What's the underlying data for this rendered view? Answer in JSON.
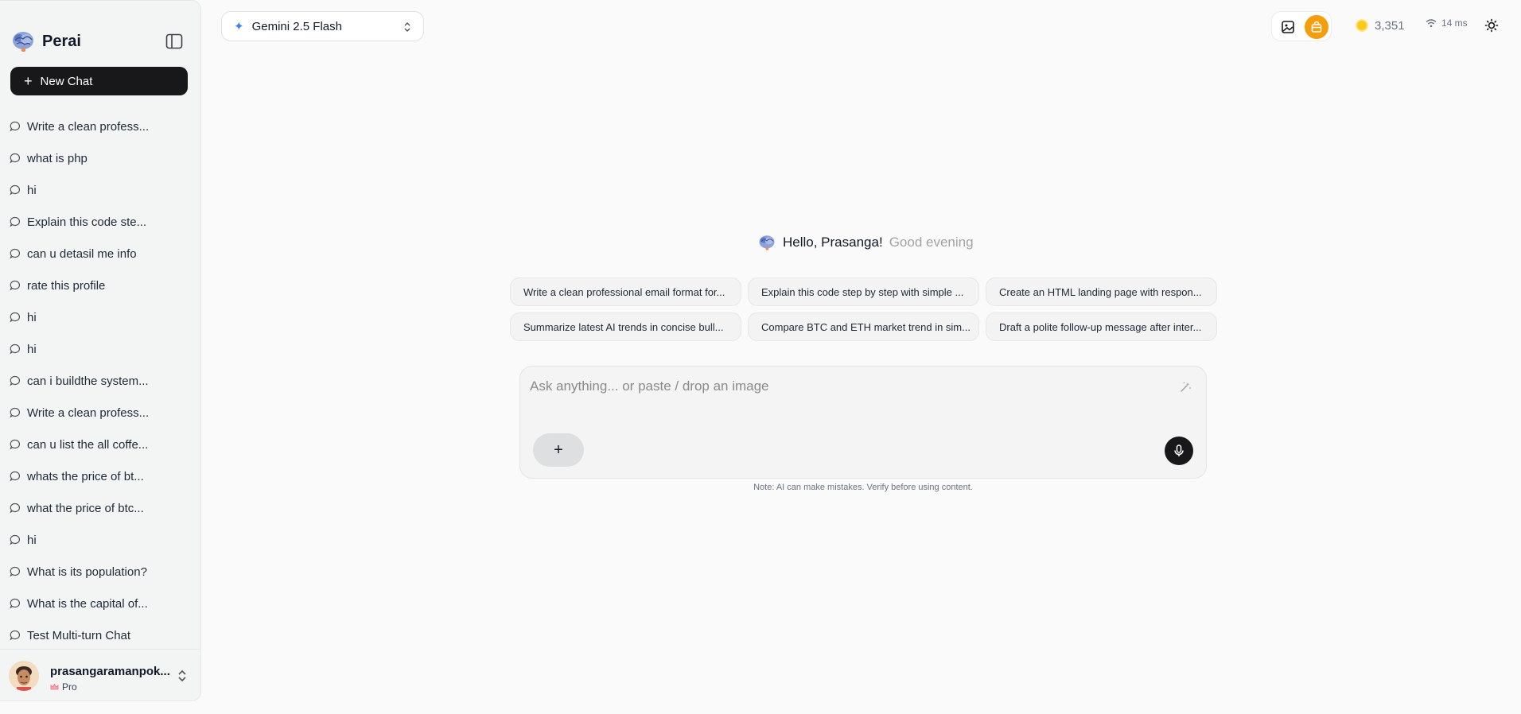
{
  "app": {
    "name": "Perai",
    "new_chat_label": "New Chat"
  },
  "history": [
    "Write a clean profess...",
    "what is php",
    "hi",
    "Explain this code ste...",
    "can u detasil me info",
    "rate this profile",
    "hi",
    "hi",
    "can i buildthe system...",
    "Write a clean profess...",
    "can u list the all coffe...",
    "whats the price of bt...",
    "what the price of btc...",
    "hi",
    "What is its population?",
    "What is the capital of...",
    "Test Multi-turn Chat"
  ],
  "user": {
    "name": "prasangaramanpok...",
    "plan": "Pro"
  },
  "topbar": {
    "model": "Gemini 2.5 Flash",
    "credits": "3,351",
    "latency": "14 ms"
  },
  "greeting": {
    "hello": "Hello, Prasanga!",
    "time_of_day": "Good evening"
  },
  "suggestions": [
    "Write a clean professional email format for...",
    "Explain this code step by step with simple ...",
    "Create an HTML landing page with respon...",
    "Summarize latest AI trends in concise bull...",
    "Compare BTC and ETH market trend in sim...",
    "Draft a polite follow-up message after inter..."
  ],
  "composer": {
    "placeholder": "Ask anything... or paste / drop an image",
    "attach_label": "+",
    "note": "Note: AI can make mistakes. Verify before using content."
  },
  "colors": {
    "accent_dark": "#18181b",
    "bag_button": "#f59e0b",
    "coin": "#facc15",
    "model_spark": "#3b82f6"
  },
  "icons": [
    "brain-logo-icon",
    "sidebar-toggle-icon",
    "plus-icon",
    "chat-bubble-icon",
    "chevron-up-down-icon",
    "image-icon",
    "shopping-bag-icon",
    "coin-icon",
    "wifi-icon",
    "sun-icon",
    "sparkle-icon",
    "magic-wand-icon",
    "microphone-icon",
    "crown-icon"
  ]
}
